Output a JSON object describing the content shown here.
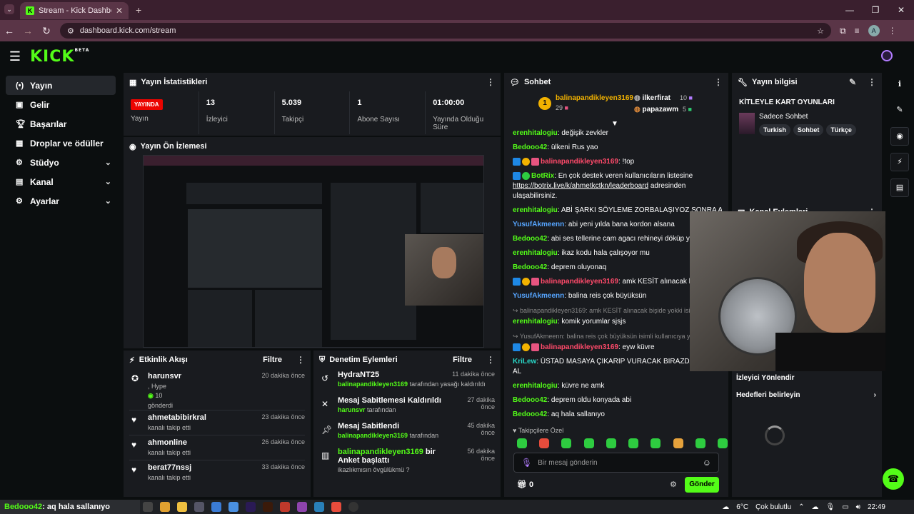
{
  "browser": {
    "tab_title": "Stream - Kick Dashboard",
    "url": "dashboard.kick.com/stream",
    "profile_initial": "A"
  },
  "header": {
    "logo": "KICK",
    "logo_sup": "BETA"
  },
  "sidebar": {
    "items": [
      {
        "label": "Yayın"
      },
      {
        "label": "Gelir"
      },
      {
        "label": "Başarılar"
      },
      {
        "label": "Droplar ve ödüller"
      },
      {
        "label": "Stüdyo"
      },
      {
        "label": "Kanal"
      },
      {
        "label": "Ayarlar"
      }
    ]
  },
  "stats": {
    "title": "Yayın İstatistikleri",
    "live_badge": "YAYINDA",
    "live_label": "Yayın",
    "items": [
      {
        "value": "13",
        "label": "İzleyici"
      },
      {
        "value": "5.039",
        "label": "Takipçi"
      },
      {
        "value": "1",
        "label": "Abone Sayısı"
      },
      {
        "value": "01:00:00",
        "label": "Yayında Olduğu Süre"
      }
    ]
  },
  "preview": {
    "title": "Yayın Ön İzlemesi"
  },
  "activity": {
    "title": "Etkinlik Akışı",
    "filter": "Filtre",
    "items": [
      {
        "name": "harunsvr",
        "sub": ", Hype",
        "amount": "10",
        "sub2": "gönderdi",
        "time": "20 dakika önce"
      },
      {
        "name": "ahmetabibirkral",
        "sub": "kanalı takip etti",
        "time": "23 dakika önce"
      },
      {
        "name": "ahmonline",
        "sub": "kanalı takip etti",
        "time": "26 dakika önce"
      },
      {
        "name": "berat77nssj",
        "sub": "kanalı takip etti",
        "time": "33 dakika önce"
      }
    ]
  },
  "moderation": {
    "title": "Denetim Eylemleri",
    "filter": "Filtre",
    "items": [
      {
        "name": "HydraNT25",
        "actor": "balinapandikleyen3169",
        "desc": "tarafından yasağı kaldırıldı",
        "time": "11 dakika önce"
      },
      {
        "name": "Mesaj Sabitlemesi Kaldırıldı",
        "actor": "harunsvr",
        "desc": "tarafından",
        "time": "27 dakika önce"
      },
      {
        "name": "Mesaj Sabitlendi",
        "actor": "balinapandikleyen3169",
        "desc": "tarafından",
        "time": "45 dakika önce"
      },
      {
        "name_actor": "balinapandikleyen3169",
        "name_rest": "bir Anket başlattı",
        "desc": "ikazlıkmısın övgülükmü ?",
        "time": "56 dakika önce"
      }
    ]
  },
  "chat": {
    "title": "Sohbet",
    "leader1": {
      "rank": "1",
      "name": "balinapandikleyen3169",
      "count": "29"
    },
    "leader2": {
      "name": "ilkerfirat",
      "count": "10"
    },
    "leader3": {
      "name": "papazawm",
      "count": "5"
    },
    "messages": [
      {
        "user": "erenhitalogiu",
        "color": "green",
        "text": "değişik zevkler"
      },
      {
        "user": "Bedooo42",
        "color": "green",
        "text": "ülkeni Rus yao"
      },
      {
        "user": "balinapandikleyen3169",
        "color": "red",
        "text": "!top",
        "badges": true
      },
      {
        "user": "BotRix",
        "color": "green",
        "text": "En çok destek veren kullanıcıların listesine",
        "link": "https://botrix.live/k/ahmetkctkn/leaderboard",
        "text2": "adresinden ulaşabilirsiniz."
      },
      {
        "user": "erenhitalogiu",
        "color": "green",
        "text": "ABİ ŞARKI SÖYLEME ZORBALAŞIYOZ SONRA AMK"
      },
      {
        "user": "YusufAkmeenn",
        "color": "blue",
        "text": "abi yeni yılda bana kordon alsana"
      },
      {
        "user": "Bedooo42",
        "color": "green",
        "text": "abi ses tellerine cam agacı rehineyi döküp yalarım"
      },
      {
        "user": "erenhitalogiu",
        "color": "green",
        "text": "ikaz kodu hala çalışoyor mu"
      },
      {
        "user": "Bedooo42",
        "color": "green",
        "text": "deprem oluyonaq"
      },
      {
        "user": "balinapandikleyen3169",
        "color": "red",
        "text": "amk KESİT alınacak bişide",
        "badges": true
      },
      {
        "user": "YusufAkmeenn",
        "color": "blue",
        "text": "balina reis çok büyüksün"
      },
      {
        "reply": "balinapandikleyen3169: amk KESİT alınacak bişide yokki isimli"
      },
      {
        "user": "erenhitalogiu",
        "color": "green",
        "text": "komik yorumlar sjsjs"
      },
      {
        "reply": "YusufAkmeenn: balina reis çok büyüksün isimli kullanıcıya yanıt"
      },
      {
        "user": "balinapandikleyen3169",
        "color": "red",
        "text": "eyw küvre",
        "badges": true
      },
      {
        "user": "KriLew",
        "color": "teal",
        "text": "ÜSTAD MASAYA ÇIKARIP VURACAK BIRAZDAN ONU AL"
      },
      {
        "user": "erenhitalogiu",
        "color": "green",
        "text": "küvre ne amk"
      },
      {
        "user": "Bedooo42",
        "color": "green",
        "text": "deprem oldu konyada abi"
      },
      {
        "user": "Bedooo42",
        "color": "green",
        "text": "aq hala sallanıyo"
      }
    ],
    "followers_only": "Takipçilere Özel",
    "input_placeholder": "Bir mesaj gönderin",
    "points": "0",
    "send": "Gönder"
  },
  "stream_info": {
    "title": "Yayın bilgisi",
    "stream_title": "KİTLEYLE KART OYUNLARI",
    "category": "Sadece Sohbet",
    "tags": [
      "Turkish",
      "Sohbet",
      "Türkçe"
    ]
  },
  "channel_actions": {
    "title": "Kanal Eylemleri",
    "redirect": "İzleyici Yönlendir",
    "goals": "Hedefleri belirleyin"
  },
  "taskbar": {
    "chat_user": "Bedooo42",
    "chat_text": "aq hala sallanıyo",
    "weather": "6°C",
    "weather_desc": "Çok bulutlu",
    "time": "22:49"
  }
}
